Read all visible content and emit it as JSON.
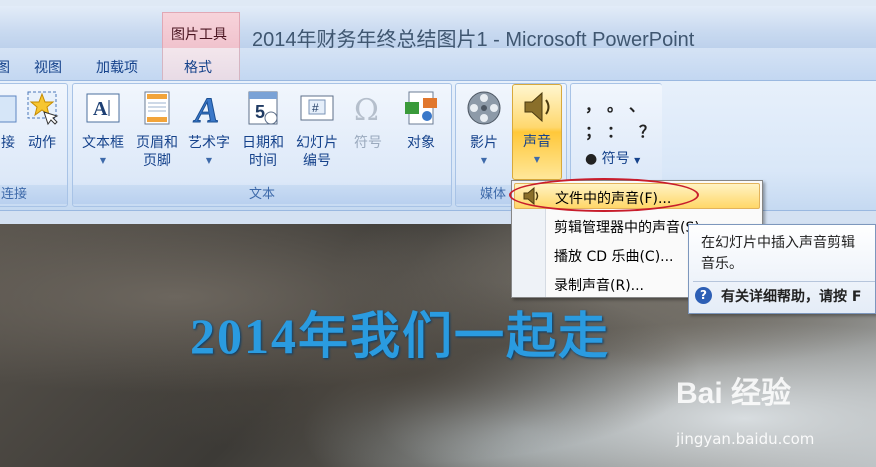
{
  "window": {
    "title": "2014年财务年终总结图片1 - Microsoft PowerPoint",
    "context_tab_group": "图片工具"
  },
  "tabs": [
    {
      "label": "图"
    },
    {
      "label": "视图"
    },
    {
      "label": "加载项"
    },
    {
      "label": "格式"
    }
  ],
  "ribbon": {
    "links_group": {
      "label": "链接",
      "partial_label": "连接",
      "buttons": [
        {
          "label": "接"
        },
        {
          "label": "动作"
        }
      ]
    },
    "text_group": {
      "label": "文本",
      "buttons": [
        {
          "label": "文本框",
          "icon": "text-box-icon"
        },
        {
          "label": "页眉和\n页脚",
          "line1": "页眉和",
          "line2": "页脚",
          "icon": "header-footer-icon"
        },
        {
          "label": "艺术字",
          "icon": "wordart-icon"
        },
        {
          "label": "日期和时间",
          "line1": "日期和",
          "line2": "时间",
          "icon": "date-time-icon"
        },
        {
          "label": "幻灯片编号",
          "line1": "幻灯片",
          "line2": "编号",
          "icon": "slide-number-icon"
        },
        {
          "label": "符号",
          "icon": "omega-icon",
          "disabled": true
        },
        {
          "label": "对象",
          "icon": "object-icon"
        }
      ]
    },
    "media_group": {
      "label": "媒体",
      "partial_label": "媒体",
      "buttons": [
        {
          "label": "影片"
        },
        {
          "label": "声音"
        }
      ]
    },
    "special_symbols": {
      "chars": [
        "，",
        "。",
        "、",
        "；",
        "：",
        "？"
      ],
      "button": "符号"
    }
  },
  "sound_menu": {
    "items": [
      {
        "label": "文件中的声音(F)...",
        "highlighted": true
      },
      {
        "label": "剪辑管理器中的声音(S)..."
      },
      {
        "label": "播放 CD 乐曲(C)..."
      },
      {
        "label": "录制声音(R)..."
      }
    ]
  },
  "tooltip": {
    "line1": "在幻灯片中插入声音剪辑",
    "line2": "音乐。",
    "help": "有关详细帮助，请按 F"
  },
  "slide": {
    "heading": "2014年我们一起走"
  },
  "watermark": {
    "brand": "Bai  经验",
    "url": "jingyan.baidu.com"
  },
  "colors": {
    "ribbon_text": "#15428b",
    "highlight": "#ffd768",
    "annotation_oval": "#c81d2c",
    "slide_heading": "#2a9be0"
  }
}
